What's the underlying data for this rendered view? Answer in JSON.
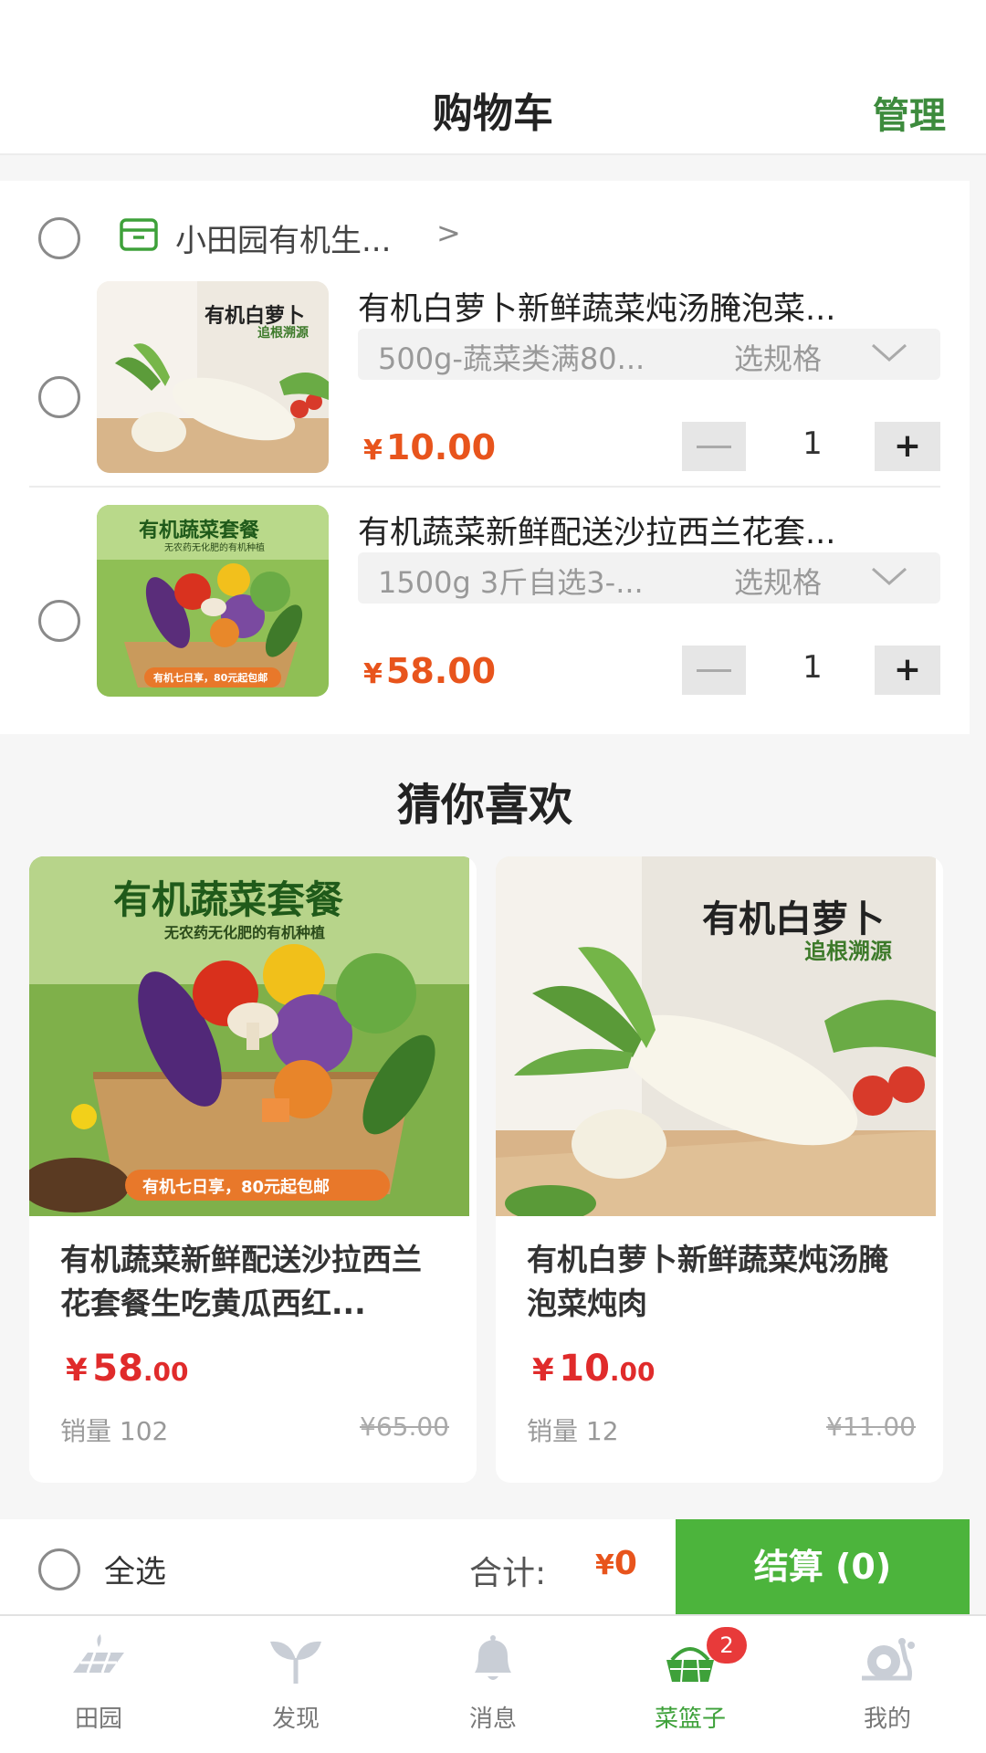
{
  "header": {
    "title": "购物车",
    "manage": "管理"
  },
  "store": {
    "name": "小田园有机生...",
    "chevron": ">"
  },
  "cart_items": [
    {
      "title": "有机白萝卜新鲜蔬菜炖汤腌泡菜...",
      "spec": "500g-蔬菜类满80...",
      "spec_pick": "选规格",
      "price_symbol": "¥",
      "price": "10.00",
      "qty": "1",
      "minus": "—",
      "plus": "+"
    },
    {
      "title": "有机蔬菜新鲜配送沙拉西兰花套...",
      "spec": "1500g 3斤自选3-...",
      "spec_pick": "选规格",
      "price_symbol": "¥",
      "price": "58.00",
      "qty": "1",
      "minus": "—",
      "plus": "+"
    }
  ],
  "thumb_text": {
    "radish": {
      "title": "有机白萝卜",
      "sub": "追根溯源"
    },
    "veg": {
      "title": "有机蔬菜套餐",
      "sub": "无农药无化肥的有机种植",
      "banner": "有机七日享，80元起包邮"
    }
  },
  "recommend": {
    "title": "猜你喜欢",
    "items": [
      {
        "name": "有机蔬菜新鲜配送沙拉西兰花套餐生吃黄瓜西红...",
        "yen": "¥",
        "price_int": "58",
        "price_dec": ".00",
        "sales": "销量 102",
        "orig": "¥65.00"
      },
      {
        "name": "有机白萝卜新鲜蔬菜炖汤腌泡菜炖肉",
        "yen": "¥",
        "price_int": "10",
        "price_dec": ".00",
        "sales": "销量 12",
        "orig": "¥11.00"
      }
    ]
  },
  "checkout": {
    "select_all": "全选",
    "total_label": "合计:",
    "total_yen": "¥",
    "total_value": "0",
    "pay_button": "结算 (0)"
  },
  "tabbar": {
    "tabs": [
      {
        "label": "田园",
        "icon": "field-icon"
      },
      {
        "label": "发现",
        "icon": "sprout-icon"
      },
      {
        "label": "消息",
        "icon": "bell-icon"
      },
      {
        "label": "菜篮子",
        "icon": "basket-icon",
        "badge": "2"
      },
      {
        "label": "我的",
        "icon": "snail-icon"
      }
    ],
    "active_index": 3
  },
  "colors": {
    "accent_green": "#4cb43c",
    "price_orange": "#e8541c",
    "price_red": "#e02b2b"
  }
}
